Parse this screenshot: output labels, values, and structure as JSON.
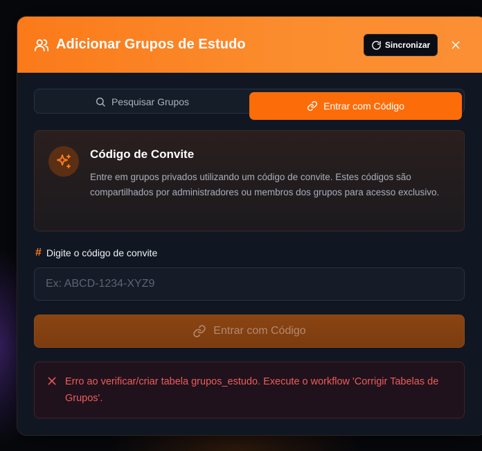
{
  "header": {
    "title": "Adicionar Grupos de Estudo",
    "icon": "users-icon",
    "sync_label": "Sincronizar",
    "close_icon": "close-icon"
  },
  "tabs": [
    {
      "label": "Pesquisar Grupos",
      "icon": "search-icon",
      "active": false
    },
    {
      "label": "Entrar com Código",
      "icon": "link-icon",
      "active": true
    }
  ],
  "invite_card": {
    "icon": "sparkles-icon",
    "title": "Código de Convite",
    "description": "Entre em grupos privados utilizando um código de convite. Estes códigos são compartilhados por administradores ou membros dos grupos para acesso exclusivo."
  },
  "code_field": {
    "label": "Digite o código de convite",
    "label_icon": "#",
    "placeholder": "Ex: ABCD-1234-XYZ9",
    "value": ""
  },
  "submit": {
    "label": "Entrar com Código",
    "icon": "link-icon",
    "disabled": true
  },
  "error": {
    "icon": "x-icon",
    "message": "Erro ao verificar/criar tabela grupos_estudo. Execute o workflow 'Corrigir Tabelas de Grupos'."
  },
  "colors": {
    "accent": "#fb7a1a",
    "error": "#f05b5b",
    "background": "#111722"
  }
}
